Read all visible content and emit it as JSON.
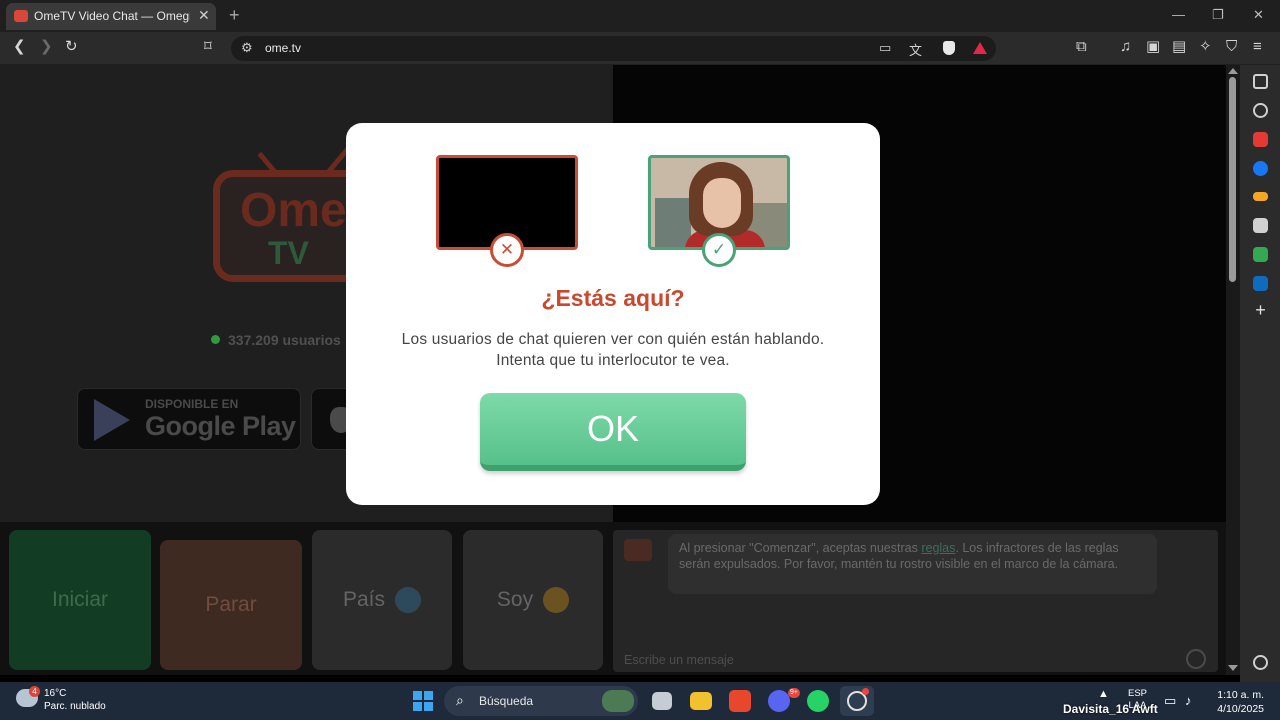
{
  "browser": {
    "tab_title": "OmeTV Video Chat — Omegle R",
    "tab_close": "✕",
    "new_tab": "+",
    "window_minimize": "—",
    "window_restore": "❐",
    "window_close": "✕",
    "url": "ome.tv"
  },
  "page": {
    "logo_ome": "Ome",
    "logo_tv": "TV",
    "online_count": "337.209 usuarios",
    "google_play": {
      "small": "DISPONIBLE EN",
      "big": "Google Play"
    },
    "buttons": {
      "start": "Iniciar",
      "stop": "Parar",
      "country": "País",
      "i_am": "Soy"
    },
    "chat": {
      "notice_before_link": "Al presionar \"Comenzar\", aceptas nuestras ",
      "notice_link": "reglas",
      "notice_after_link": ". Los infractores de las reglas serán expulsados. Por favor, mantén tu rostro visible en el marco de la cámara.",
      "input_placeholder": "Escribe un mensaje"
    }
  },
  "modal": {
    "title": "¿Estás aquí?",
    "text_line1": "Los usuarios de chat quieren ver con quién están hablando.",
    "text_line2": "Intenta que tu interlocutor te vea.",
    "ok_label": "OK",
    "bad_badge": "✕",
    "good_badge": "✓"
  },
  "taskbar": {
    "weather_badge": "4",
    "weather_temp": "16°C",
    "weather_desc": "Parc. nublado",
    "search_label": "Búsqueda",
    "discord_badge": "9+",
    "overlay_label": "Davisita_16 Awft",
    "lang_line1": "ESP",
    "lang_line2": "LAA",
    "time": "1:10 a. m.",
    "date": "4/10/2025"
  },
  "colors": {
    "accent_red": "#c9492f",
    "accent_green": "#57c18a",
    "brave_red": "#e0284b"
  }
}
